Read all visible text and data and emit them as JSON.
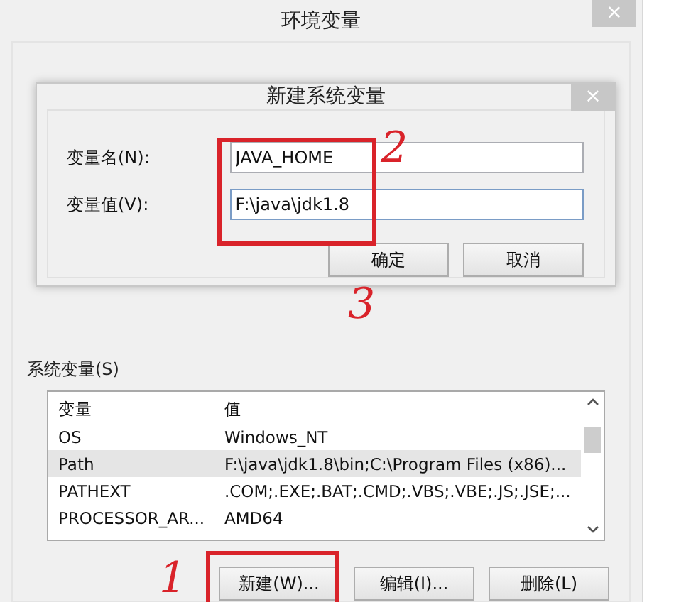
{
  "window": {
    "title": "环境变量",
    "close": "×"
  },
  "dialog": {
    "title": "新建系统变量",
    "close": "×",
    "fields": [
      {
        "label": "变量名(N):",
        "value": "JAVA_HOME",
        "focused": false
      },
      {
        "label": "变量值(V):",
        "value": "F:\\java\\jdk1.8",
        "focused": true
      }
    ],
    "buttons": [
      "确定",
      "取消"
    ]
  },
  "system_variables": {
    "label": "系统变量(S)",
    "columns": [
      "变量",
      "值"
    ],
    "rows": [
      {
        "name": "OS",
        "value": "Windows_NT",
        "selected": false
      },
      {
        "name": "Path",
        "value": "F:\\java\\jdk1.8\\bin;C:\\Program Files (x86)...",
        "selected": true
      },
      {
        "name": "PATHEXT",
        "value": ".COM;.EXE;.BAT;.CMD;.VBS;.VBE;.JS;.JSE;...",
        "selected": false
      },
      {
        "name": "PROCESSOR_AR...",
        "value": "AMD64",
        "selected": false
      }
    ],
    "buttons": [
      "新建(W)...",
      "编辑(I)...",
      "删除(L)"
    ]
  },
  "annotations": [
    {
      "label": "2"
    },
    {
      "label": "3"
    },
    {
      "label": "1"
    }
  ]
}
